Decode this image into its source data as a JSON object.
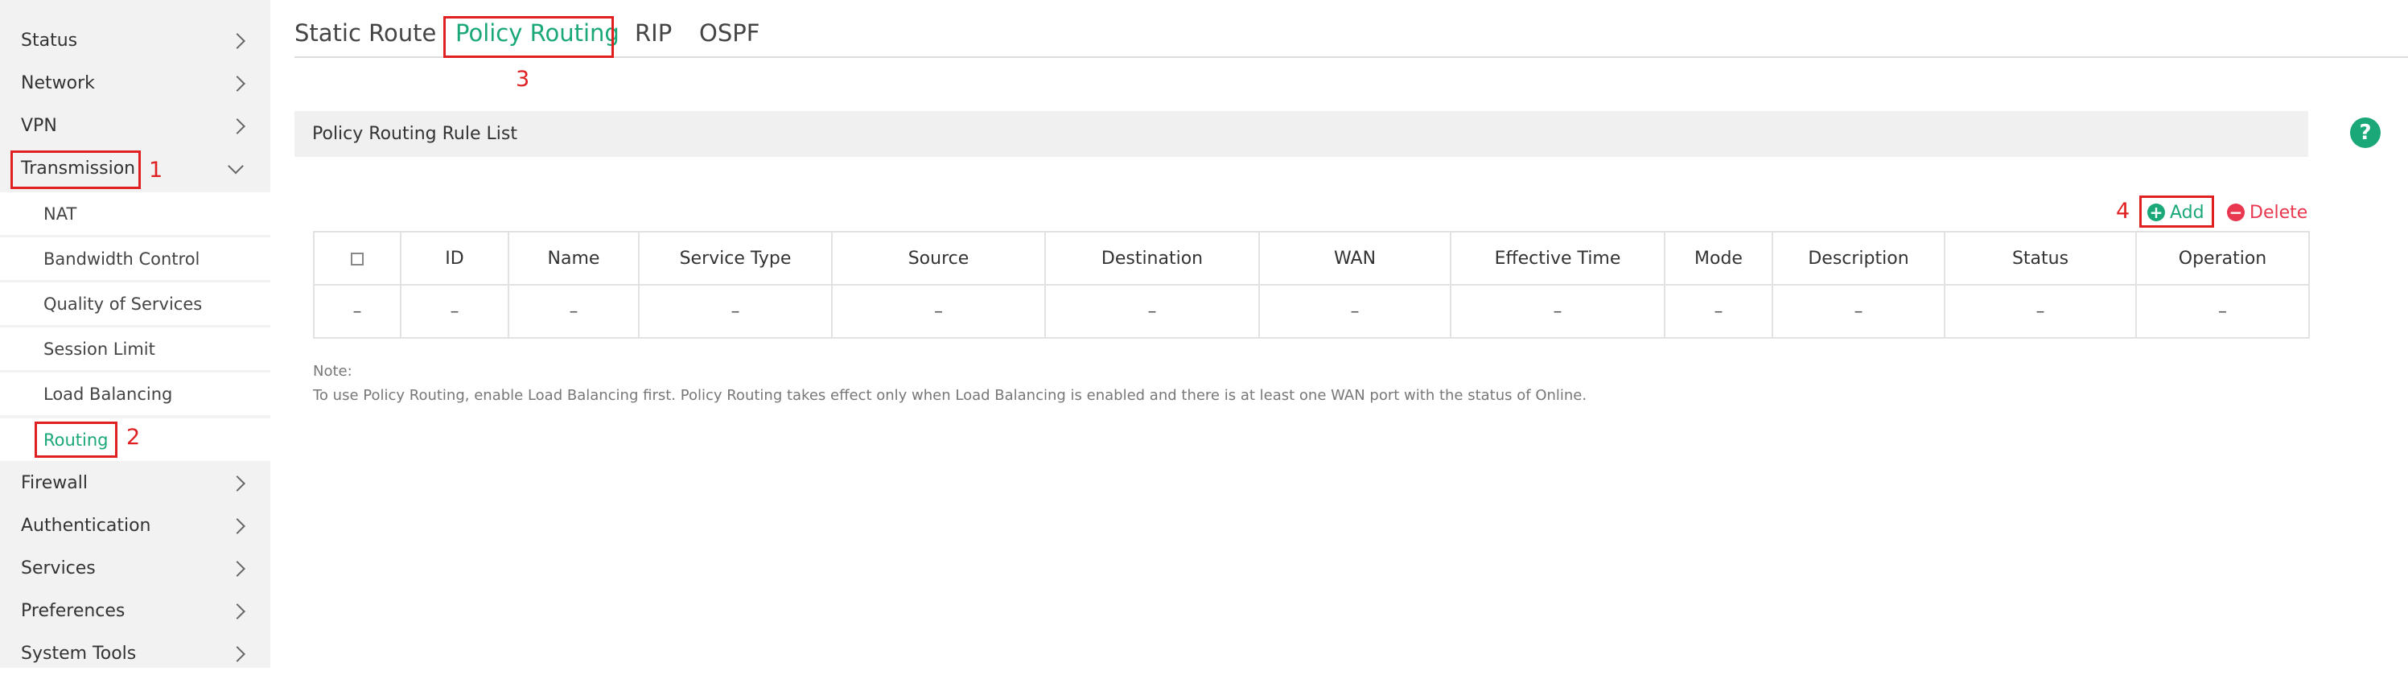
{
  "sidebar": {
    "items": [
      {
        "label": "Status"
      },
      {
        "label": "Network"
      },
      {
        "label": "VPN"
      },
      {
        "label": "Transmission"
      },
      {
        "label": "NAT"
      },
      {
        "label": "Bandwidth Control"
      },
      {
        "label": "Quality of Services"
      },
      {
        "label": "Session Limit"
      },
      {
        "label": "Load Balancing"
      },
      {
        "label": "Routing"
      },
      {
        "label": "Firewall"
      },
      {
        "label": "Authentication"
      },
      {
        "label": "Services"
      },
      {
        "label": "Preferences"
      },
      {
        "label": "System Tools"
      }
    ]
  },
  "tabs": [
    {
      "label": "Static Route"
    },
    {
      "label": "Policy Routing"
    },
    {
      "label": "RIP"
    },
    {
      "label": "OSPF"
    }
  ],
  "annotations": [
    "1",
    "2",
    "3",
    "4"
  ],
  "panel": {
    "title": "Policy Routing Rule List",
    "help_glyph": "?",
    "add_label": "Add",
    "delete_label": "Delete"
  },
  "table": {
    "headers": [
      "ID",
      "Name",
      "Service Type",
      "Source",
      "Destination",
      "WAN",
      "Effective Time",
      "Mode",
      "Description",
      "Status",
      "Operation"
    ],
    "rows": [
      [
        "–",
        "–",
        "–",
        "–",
        "–",
        "–",
        "–",
        "–",
        "–",
        "–",
        "–",
        "–"
      ]
    ]
  },
  "note": {
    "heading": "Note:",
    "text": "To use Policy Routing, enable Load Balancing first. Policy Routing takes effect only when Load Balancing is enabled and there is at least one WAN port with the status of Online."
  },
  "colors": {
    "accent": "#1aa878",
    "danger": "#e8374f",
    "annotation": "#e02020",
    "sidebar_bg": "#f2f2f2"
  }
}
